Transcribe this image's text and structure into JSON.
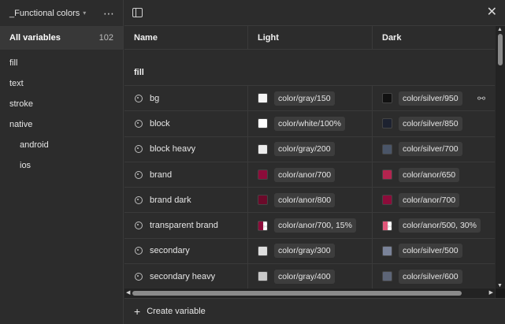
{
  "sidebar": {
    "collection_title": "_Functional colors",
    "all_variables_label": "All variables",
    "all_variables_count": "102",
    "groups": [
      {
        "label": "fill",
        "sub": false
      },
      {
        "label": "text",
        "sub": false
      },
      {
        "label": "stroke",
        "sub": false
      },
      {
        "label": "native",
        "sub": false
      },
      {
        "label": "android",
        "sub": true
      },
      {
        "label": "ios",
        "sub": true
      }
    ]
  },
  "table": {
    "headers": {
      "name": "Name",
      "light": "Light",
      "dark": "Dark"
    },
    "group_label": "fill",
    "rows": [
      {
        "name": "bg",
        "light": {
          "value": "color/gray/150",
          "color": "#f4f4f4"
        },
        "dark": {
          "value": "color/silver/950",
          "color": "#111111"
        }
      },
      {
        "name": "block",
        "light": {
          "value": "color/white/100%",
          "color": "#ffffff"
        },
        "dark": {
          "value": "color/silver/850",
          "color": "#1d2230"
        }
      },
      {
        "name": "block heavy",
        "light": {
          "value": "color/gray/200",
          "color": "#ececec"
        },
        "dark": {
          "value": "color/silver/700",
          "color": "#4a5568"
        }
      },
      {
        "name": "brand",
        "light": {
          "value": "color/anor/700",
          "color": "#8c0c3a"
        },
        "dark": {
          "value": "color/anor/650",
          "color": "#b3244f"
        }
      },
      {
        "name": "brand dark",
        "light": {
          "value": "color/anor/800",
          "color": "#6b0a2a"
        },
        "dark": {
          "value": "color/anor/700",
          "color": "#8c0c3a"
        }
      },
      {
        "name": "transparent brand",
        "light": {
          "value": "color/anor/700, 15%",
          "color": "#8c0c3a",
          "transparent": true
        },
        "dark": {
          "value": "color/anor/500, 30%",
          "color": "#e0577a",
          "transparent": true
        }
      },
      {
        "name": "secondary",
        "light": {
          "value": "color/gray/300",
          "color": "#dedede"
        },
        "dark": {
          "value": "color/silver/500",
          "color": "#7a8399"
        }
      },
      {
        "name": "secondary heavy",
        "light": {
          "value": "color/gray/400",
          "color": "#c8c8c8"
        },
        "dark": {
          "value": "color/silver/600",
          "color": "#5d6577"
        }
      }
    ]
  },
  "footer": {
    "create_label": "Create variable"
  },
  "icons": {
    "collection_menu": "chevron-down-icon",
    "more": "more-icon",
    "panel": "sidebar-toggle-icon",
    "close": "close-icon",
    "row": "palette-icon",
    "link": "unlink-icon",
    "add": "plus-icon"
  }
}
